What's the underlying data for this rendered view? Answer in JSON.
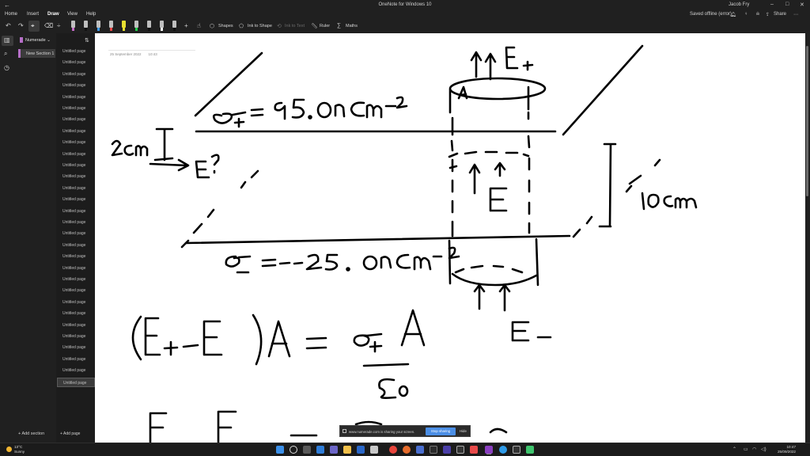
{
  "window": {
    "title": "OneNote for Windows 10",
    "user": "Jacob Fry"
  },
  "menu": {
    "items": [
      "Home",
      "Insert",
      "Draw",
      "View",
      "Help"
    ],
    "active": "Draw",
    "sync_status": "Saved offline (error)",
    "share_label": "Share"
  },
  "toolbar": {
    "shapes_label": "Shapes",
    "ink_to_shape_label": "Ink to Shape",
    "ink_to_text_label": "Ink to Text",
    "ruler_label": "Ruler",
    "maths_label": "Maths",
    "pen_colors": [
      "#c66cc9",
      "#111111",
      "#3e9cf0",
      "#e84545",
      "#e8e030",
      "#22cf4a",
      "#111111",
      "#ffffff",
      "#111111",
      "#ffffff"
    ]
  },
  "notebook": {
    "name": "Numerade",
    "section": "New Section 1",
    "add_section_label": "Add section",
    "add_page_label": "Add page"
  },
  "pages": {
    "items": [
      "Untitled page",
      "Untitled page",
      "Untitled page",
      "Untitled page",
      "Untitled page",
      "Untitled page",
      "Untitled page",
      "Untitled page",
      "Untitled page",
      "Untitled page",
      "Untitled page",
      "Untitled page",
      "Untitled page",
      "Untitled page",
      "Untitled page",
      "Untitled page",
      "Untitled page",
      "Untitled page",
      "Untitled page",
      "Untitled page",
      "Untitled page",
      "Untitled page",
      "Untitled page",
      "Untitled page",
      "Untitled page",
      "Untitled page",
      "Untitled page",
      "Untitled page",
      "Untitled page",
      "Untitled page"
    ],
    "active_index": 29
  },
  "canvas": {
    "date": "25 September 2022",
    "time": "10:43"
  },
  "toast": {
    "message": "www.numerade.com is sharing your screen.",
    "stop_label": "Stop sharing",
    "hide_label": "Hide"
  },
  "taskbar": {
    "temperature": "13°C",
    "weather_condition": "Sunny",
    "time": "10:47",
    "date": "25/09/2022"
  }
}
